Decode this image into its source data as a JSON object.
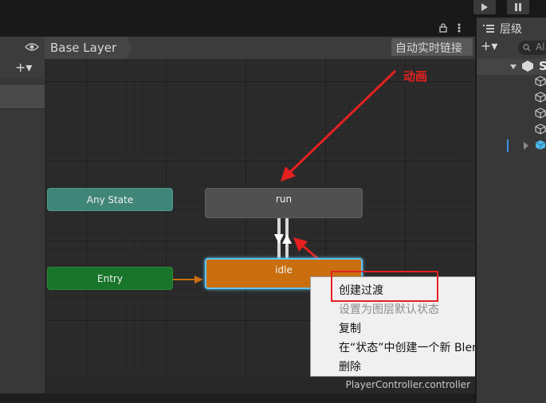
{
  "colors": {
    "accent_selection": "#5ec4f2",
    "any_state": "#3f8578",
    "entry": "#18752a",
    "idle": "#c96f10",
    "run": "#505050",
    "annotation_red": "#e62020"
  },
  "toolbar": {
    "play_icon": "play-icon",
    "pause_icon": "pause-icon"
  },
  "animator": {
    "lock_icon": "lock-icon",
    "more_icon": "vertical-ellipsis-icon",
    "eye_icon": "eye-icon",
    "breadcrumb": "Base Layer",
    "auto_live_link": "自动实时链接",
    "add_label": "+▾",
    "footer_path": "PlayerController.controller"
  },
  "nodes": {
    "any_state": "Any State",
    "entry": "Entry",
    "run": "run",
    "idle": "idle"
  },
  "annotation": {
    "label": "动画"
  },
  "context_menu": {
    "items": [
      {
        "label": "创建过渡",
        "enabled": true
      },
      {
        "label": "设置为图层默认状态",
        "enabled": false
      },
      {
        "label": "复制",
        "enabled": true
      },
      {
        "label": "在“状态”中创建一个新 BlendTree",
        "enabled": true
      },
      {
        "label": "删除",
        "enabled": true
      }
    ]
  },
  "hierarchy": {
    "tab_icon": "list-icon",
    "tab_label": "层级",
    "add_label": "+▾",
    "search_text": "Al",
    "scene_initial": "S"
  }
}
